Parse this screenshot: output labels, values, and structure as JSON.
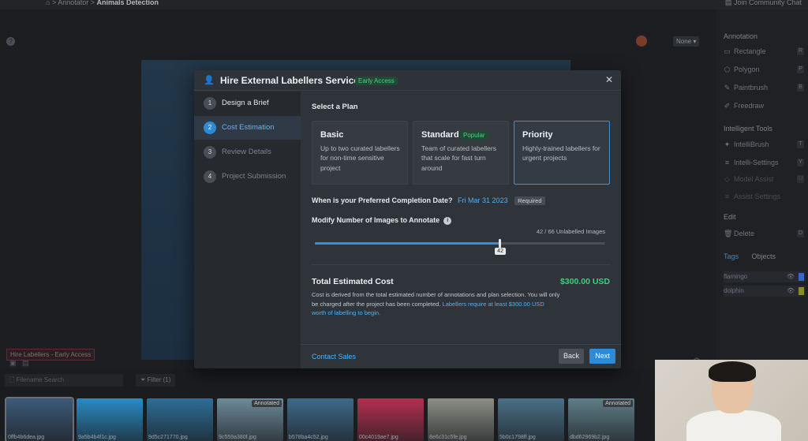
{
  "topbar": {
    "crumb1": "Annotator",
    "crumb2": "Animals Detection",
    "community": "Join Community Chat"
  },
  "workspace": {
    "select_value": "None",
    "hire_chip": "Hire Labellers - Early Access"
  },
  "right_panel": {
    "annotation_title": "Annotation",
    "tools": [
      {
        "label": "Rectangle",
        "key": "R"
      },
      {
        "label": "Polygon",
        "key": "P"
      },
      {
        "label": "Paintbrush",
        "key": "B"
      },
      {
        "label": "Freedraw",
        "key": ""
      }
    ],
    "intelligent_title": "Intelligent Tools",
    "intel_tools": [
      {
        "label": "IntelliBrush",
        "key": "T"
      },
      {
        "label": "Intelli-Settings",
        "key": "Y"
      },
      {
        "label": "Model Assist",
        "key": "U"
      },
      {
        "label": "Assist Settings",
        "key": ""
      }
    ],
    "edit_title": "Edit",
    "delete_label": "Delete",
    "delete_key": "D",
    "tab_tags": "Tags",
    "tab_objects": "Objects",
    "tags": [
      {
        "label": "flamingo",
        "color": "#3b66c9"
      },
      {
        "label": "dolphin",
        "color": "#8a8b2a"
      }
    ]
  },
  "bottom": {
    "search_placeholder": "Filename Search",
    "filter_label": "Filter (1)",
    "thumbs": [
      {
        "caption": "0ffb4b6dea.jpg",
        "annotated": "",
        "color": "#3d5a78"
      },
      {
        "caption": "9a5b4b4f1c.jpg",
        "annotated": "",
        "color": "#2a8bc4"
      },
      {
        "caption": "9d5c271770.jpg",
        "annotated": "",
        "color": "#2d6e97"
      },
      {
        "caption": "9c559a380f.jpg",
        "annotated": "Annotated",
        "color": "#6d8a99"
      },
      {
        "caption": "b578ba4c52.jpg",
        "annotated": "",
        "color": "#3f6a8a"
      },
      {
        "caption": "00c4019ae7.jpg",
        "annotated": "",
        "color": "#b3304f"
      },
      {
        "caption": "8e6c31c5fe.jpg",
        "annotated": "",
        "color": "#8c8e86"
      },
      {
        "caption": "5b0c1798ff.jpg",
        "annotated": "",
        "color": "#4a7088"
      },
      {
        "caption": "dbd62969b2.jpg",
        "annotated": "Annotated",
        "color": "#5f7e88"
      }
    ]
  },
  "modal": {
    "title": "Hire External Labellers Service",
    "badge": "Early Access",
    "steps": [
      {
        "num": "1",
        "label": "Design a Brief"
      },
      {
        "num": "2",
        "label": "Cost Estimation"
      },
      {
        "num": "3",
        "label": "Review Details"
      },
      {
        "num": "4",
        "label": "Project Submission"
      }
    ],
    "active_step": 2,
    "select_plan": "Select a Plan",
    "plans": [
      {
        "name": "Basic",
        "badge": "",
        "desc": "Up to two curated labellers for non-time sensitive project"
      },
      {
        "name": "Standard",
        "badge": "Popular",
        "desc": "Team of curated labellers that scale for fast turn around"
      },
      {
        "name": "Priority",
        "badge": "",
        "desc": "Highly-trained labellers for urgent projects"
      }
    ],
    "selected_plan": "Priority",
    "date_label": "When is your Preferred Completion Date?",
    "date_value": "Fri Mar 31 2023",
    "required": "Required",
    "modify_label": "Modify Number of Images to Annotate",
    "count_text": "42 / 66 Unlabelled Images",
    "slider_value": 42,
    "slider_max": 66,
    "slider_tip": "42",
    "cost_title": "Total Estimated Cost",
    "cost_value": "$300.00 USD",
    "cost_desc": "Cost is derived from the total estimated number of annotations and plan selection. You will only be charged after the project has been completed.",
    "cost_link": "Labellers require at least $300.00 USD worth of labelling to begin.",
    "contact": "Contact Sales",
    "back": "Back",
    "next": "Next"
  }
}
